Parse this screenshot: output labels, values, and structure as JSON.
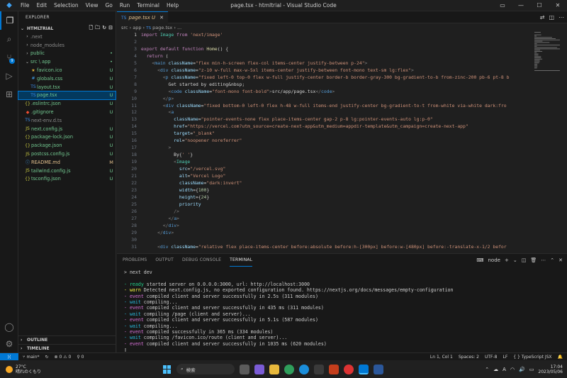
{
  "window": {
    "title": "page.tsx - htmltrial - Visual Studio Code",
    "menu": [
      "File",
      "Edit",
      "Selection",
      "View",
      "Go",
      "Run",
      "Terminal",
      "Help"
    ]
  },
  "explorer": {
    "header": "EXPLORER",
    "root": "HTMLTRIAL",
    "outline": "OUTLINE",
    "timeline": "TIMELINE",
    "items": [
      {
        "name": ".next",
        "indent": 1,
        "kind": "folder",
        "status": "",
        "dim": true
      },
      {
        "name": "node_modules",
        "indent": 1,
        "kind": "folder",
        "status": "",
        "dim": true
      },
      {
        "name": "public",
        "indent": 1,
        "kind": "folder",
        "status": "•",
        "color": "u"
      },
      {
        "name": "src \\ app",
        "indent": 1,
        "kind": "folder-open",
        "status": "•",
        "color": "u"
      },
      {
        "name": "favicon.ico",
        "indent": 2,
        "kind": "ico",
        "status": "U",
        "color": "u"
      },
      {
        "name": "globals.css",
        "indent": 2,
        "kind": "css",
        "status": "U",
        "color": "u"
      },
      {
        "name": "layout.tsx",
        "indent": 2,
        "kind": "ts",
        "status": "U",
        "color": "u"
      },
      {
        "name": "page.tsx",
        "indent": 2,
        "kind": "ts",
        "status": "U",
        "color": "u",
        "selected": true
      },
      {
        "name": ".eslintrc.json",
        "indent": 1,
        "kind": "json",
        "status": "U",
        "color": "u"
      },
      {
        "name": ".gitignore",
        "indent": 1,
        "kind": "git",
        "status": "U",
        "color": "u"
      },
      {
        "name": "next-env.d.ts",
        "indent": 1,
        "kind": "ts",
        "status": "",
        "dim": true
      },
      {
        "name": "next.config.js",
        "indent": 1,
        "kind": "js",
        "status": "U",
        "color": "u"
      },
      {
        "name": "package-lock.json",
        "indent": 1,
        "kind": "json",
        "status": "U",
        "color": "u"
      },
      {
        "name": "package.json",
        "indent": 1,
        "kind": "json",
        "status": "U",
        "color": "u"
      },
      {
        "name": "postcss.config.js",
        "indent": 1,
        "kind": "js",
        "status": "U",
        "color": "u"
      },
      {
        "name": "README.md",
        "indent": 1,
        "kind": "md",
        "status": "M",
        "color": "m"
      },
      {
        "name": "tailwind.config.js",
        "indent": 1,
        "kind": "js",
        "status": "U",
        "color": "u"
      },
      {
        "name": "tsconfig.json",
        "indent": 1,
        "kind": "json",
        "status": "U",
        "color": "u"
      }
    ]
  },
  "editor": {
    "tab": "page.tsx",
    "tab_status": "U",
    "breadcrumb": [
      "src",
      "app",
      "page.tsx",
      "..."
    ],
    "lines": [
      {
        "n": "1",
        "t": [
          [
            "k",
            "import "
          ],
          [
            "v",
            "Image "
          ],
          [
            "k",
            "from "
          ],
          [
            "s",
            "'next/image'"
          ]
        ]
      },
      {
        "n": "2",
        "t": []
      },
      {
        "n": "3",
        "t": [
          [
            "k",
            "export default function "
          ],
          [
            "f",
            "Home"
          ],
          [
            "p",
            "() {"
          ]
        ]
      },
      {
        "n": "4",
        "t": [
          [
            "p",
            "  "
          ],
          [
            "k",
            "return "
          ],
          [
            "p",
            "("
          ]
        ]
      },
      {
        "n": "5",
        "t": [
          [
            "p",
            "    "
          ],
          [
            "g",
            "<"
          ],
          [
            "t",
            "main "
          ],
          [
            "a",
            "className"
          ],
          [
            "p",
            "="
          ],
          [
            "s",
            "\"flex min-h-screen flex-col items-center justify-between p-24\""
          ],
          [
            "g",
            ">"
          ]
        ]
      },
      {
        "n": "6",
        "t": [
          [
            "p",
            "      "
          ],
          [
            "g",
            "<"
          ],
          [
            "t",
            "div "
          ],
          [
            "a",
            "className"
          ],
          [
            "p",
            "="
          ],
          [
            "s",
            "\"z-10 w-full max-w-5xl items-center justify-between font-mono text-sm lg:flex\""
          ],
          [
            "g",
            ">"
          ]
        ]
      },
      {
        "n": "7",
        "t": [
          [
            "p",
            "        "
          ],
          [
            "g",
            "<"
          ],
          [
            "t",
            "p "
          ],
          [
            "a",
            "className"
          ],
          [
            "p",
            "="
          ],
          [
            "s",
            "\"fixed left-0 top-0 flex w-full justify-center border-b border-gray-300 bg-gradient-to-b from-zinc-200 pb-6 pt-8 b"
          ]
        ]
      },
      {
        "n": "8",
        "t": [
          [
            "p",
            "          Get started by editing&nbsp;"
          ]
        ]
      },
      {
        "n": "9",
        "t": [
          [
            "p",
            "          "
          ],
          [
            "g",
            "<"
          ],
          [
            "t",
            "code "
          ],
          [
            "a",
            "className"
          ],
          [
            "p",
            "="
          ],
          [
            "s",
            "\"font-mono font-bold\""
          ],
          [
            "g",
            ">"
          ],
          [
            "p",
            "src/app/page.tsx"
          ],
          [
            "g",
            "</"
          ],
          [
            "t",
            "code"
          ],
          [
            "g",
            ">"
          ]
        ]
      },
      {
        "n": "10",
        "t": [
          [
            "p",
            "        "
          ],
          [
            "g",
            "</"
          ],
          [
            "t",
            "p"
          ],
          [
            "g",
            ">"
          ]
        ]
      },
      {
        "n": "11",
        "t": [
          [
            "p",
            "        "
          ],
          [
            "g",
            "<"
          ],
          [
            "t",
            "div "
          ],
          [
            "a",
            "className"
          ],
          [
            "p",
            "="
          ],
          [
            "s",
            "\"fixed bottom-0 left-0 flex h-48 w-full items-end justify-center bg-gradient-to-t from-white via-white dark:fro"
          ]
        ]
      },
      {
        "n": "12",
        "t": [
          [
            "p",
            "          "
          ],
          [
            "g",
            "<"
          ],
          [
            "t",
            "a"
          ]
        ]
      },
      {
        "n": "13",
        "t": [
          [
            "p",
            "            "
          ],
          [
            "a",
            "className"
          ],
          [
            "p",
            "="
          ],
          [
            "s",
            "\"pointer-events-none flex place-items-center gap-2 p-8 lg:pointer-events-auto lg:p-0\""
          ]
        ]
      },
      {
        "n": "14",
        "t": [
          [
            "p",
            "            "
          ],
          [
            "a",
            "href"
          ],
          [
            "p",
            "="
          ],
          [
            "s",
            "\"https://vercel.com?utm_source=create-next-app&utm_medium=appdir-template&utm_campaign=create-next-app\""
          ]
        ]
      },
      {
        "n": "15",
        "t": [
          [
            "p",
            "            "
          ],
          [
            "a",
            "target"
          ],
          [
            "p",
            "="
          ],
          [
            "s",
            "\"_blank\""
          ]
        ]
      },
      {
        "n": "16",
        "t": [
          [
            "p",
            "            "
          ],
          [
            "a",
            "rel"
          ],
          [
            "p",
            "="
          ],
          [
            "s",
            "\"noopener noreferrer\""
          ]
        ]
      },
      {
        "n": "17",
        "t": [
          [
            "p",
            "          "
          ],
          [
            "g",
            ">"
          ]
        ]
      },
      {
        "n": "18",
        "t": [
          [
            "p",
            "            By{"
          ],
          [
            "s",
            "' '"
          ],
          [
            "p",
            "}"
          ]
        ]
      },
      {
        "n": "19",
        "t": [
          [
            "p",
            "            "
          ],
          [
            "g",
            "<"
          ],
          [
            "v",
            "Image"
          ]
        ]
      },
      {
        "n": "20",
        "t": [
          [
            "p",
            "              "
          ],
          [
            "a",
            "src"
          ],
          [
            "p",
            "="
          ],
          [
            "s",
            "\"/vercel.svg\""
          ]
        ]
      },
      {
        "n": "21",
        "t": [
          [
            "p",
            "              "
          ],
          [
            "a",
            "alt"
          ],
          [
            "p",
            "="
          ],
          [
            "s",
            "\"Vercel Logo\""
          ]
        ]
      },
      {
        "n": "22",
        "t": [
          [
            "p",
            "              "
          ],
          [
            "a",
            "className"
          ],
          [
            "p",
            "="
          ],
          [
            "s",
            "\"dark:invert\""
          ]
        ]
      },
      {
        "n": "23",
        "t": [
          [
            "p",
            "              "
          ],
          [
            "a",
            "width"
          ],
          [
            "p",
            "={"
          ],
          [
            "n",
            "100"
          ],
          [
            "p",
            "}"
          ]
        ]
      },
      {
        "n": "24",
        "t": [
          [
            "p",
            "              "
          ],
          [
            "a",
            "height"
          ],
          [
            "p",
            "={"
          ],
          [
            "n",
            "24"
          ],
          [
            "p",
            "}"
          ]
        ]
      },
      {
        "n": "25",
        "t": [
          [
            "p",
            "              "
          ],
          [
            "a",
            "priority"
          ]
        ]
      },
      {
        "n": "26",
        "t": [
          [
            "p",
            "            "
          ],
          [
            "g",
            "/>"
          ]
        ]
      },
      {
        "n": "27",
        "t": [
          [
            "p",
            "          "
          ],
          [
            "g",
            "</"
          ],
          [
            "t",
            "a"
          ],
          [
            "g",
            ">"
          ]
        ]
      },
      {
        "n": "28",
        "t": [
          [
            "p",
            "        "
          ],
          [
            "g",
            "</"
          ],
          [
            "t",
            "div"
          ],
          [
            "g",
            ">"
          ]
        ]
      },
      {
        "n": "29",
        "t": [
          [
            "p",
            "      "
          ],
          [
            "g",
            "</"
          ],
          [
            "t",
            "div"
          ],
          [
            "g",
            ">"
          ]
        ]
      },
      {
        "n": "30",
        "t": []
      },
      {
        "n": "31",
        "t": [
          [
            "p",
            "      "
          ],
          [
            "g",
            "<"
          ],
          [
            "t",
            "div "
          ],
          [
            "a",
            "className"
          ],
          [
            "p",
            "="
          ],
          [
            "s",
            "\"relative flex place-items-center before:absolute before:h-[300px] before:w-[480px] before:-translate-x-1/2 befor"
          ]
        ]
      }
    ]
  },
  "panel": {
    "tabs": [
      "PROBLEMS",
      "OUTPUT",
      "DEBUG CONSOLE",
      "TERMINAL"
    ],
    "active": "TERMINAL",
    "shell": "node",
    "terminal": [
      {
        "c": "",
        "t": "> next dev"
      },
      {
        "c": "",
        "t": ""
      },
      {
        "c": "t-ready",
        "p": "- ready",
        "t": " started server on 0.0.0.0:3000, url: http://localhost:3000"
      },
      {
        "c": "t-warn",
        "p": "- warn",
        "t": " Detected next.config.js, no exported configuration found. https://nextjs.org/docs/messages/empty-configuration"
      },
      {
        "c": "t-event",
        "p": "- event",
        "t": " compiled client and server successfully in 2.5s (311 modules)"
      },
      {
        "c": "t-wait",
        "p": "- wait",
        "t": " compiling..."
      },
      {
        "c": "t-event",
        "p": "- event",
        "t": " compiled client and server successfully in 435 ms (311 modules)"
      },
      {
        "c": "t-wait",
        "p": "- wait",
        "t": " compiling /page (client and server)..."
      },
      {
        "c": "t-event",
        "p": "- event",
        "t": " compiled client and server successfully in 5.1s (587 modules)"
      },
      {
        "c": "t-wait",
        "p": "- wait",
        "t": " compiling..."
      },
      {
        "c": "t-event",
        "p": "- event",
        "t": " compiled successfully in 365 ms (334 modules)"
      },
      {
        "c": "t-wait",
        "p": "- wait",
        "t": " compiling /favicon.ico/route (client and server)..."
      },
      {
        "c": "t-event",
        "p": "- event",
        "t": " compiled client and server successfully in 1035 ms (620 modules)"
      },
      {
        "c": "",
        "t": "▯"
      }
    ]
  },
  "status": {
    "branch": "main*",
    "errors": "0",
    "warnings": "0",
    "sync": "0",
    "position": "Ln 1, Col 1",
    "spaces": "Spaces: 2",
    "encoding": "UTF-8",
    "eol": "LF",
    "lang": "TypeScript JSX"
  },
  "taskbar": {
    "temp": "27°C",
    "weather": "晴れのくもり",
    "search": "検索",
    "time": "17:04",
    "date": "2023/05/06",
    "lang": "A"
  },
  "colors": {
    "accent": "#0078d4",
    "keyword": "#c586c0",
    "string": "#ce9178",
    "tag": "#569cd6",
    "attr": "#9cdcfe",
    "func": "#dcdcaa",
    "type": "#4ec9b0",
    "num": "#b5cea8"
  }
}
